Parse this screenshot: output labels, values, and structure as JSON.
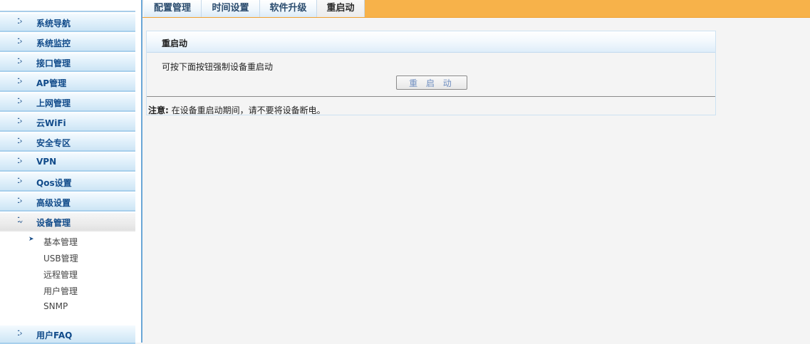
{
  "sidebar": {
    "items": [
      {
        "label": "系统导航"
      },
      {
        "label": "系统监控"
      },
      {
        "label": "接口管理"
      },
      {
        "label": "AP管理"
      },
      {
        "label": "上网管理"
      },
      {
        "label": "云WiFi"
      },
      {
        "label": "安全专区"
      },
      {
        "label": "VPN"
      },
      {
        "label": "Qos设置"
      },
      {
        "label": "高级设置"
      },
      {
        "label": "设备管理",
        "expanded": true
      },
      {
        "label": "用户FAQ"
      }
    ],
    "sub_items": [
      {
        "label": "基本管理",
        "selected": true
      },
      {
        "label": "USB管理"
      },
      {
        "label": "远程管理"
      },
      {
        "label": "用户管理"
      },
      {
        "label": "SNMP"
      }
    ]
  },
  "tabs": [
    {
      "label": "配置管理"
    },
    {
      "label": "时间设置"
    },
    {
      "label": "软件升级"
    },
    {
      "label": "重启动",
      "active": true
    }
  ],
  "panel": {
    "title": "重启动",
    "description": "可按下面按钮强制设备重启动",
    "button_label": "重 启 动",
    "note_label": "注意:",
    "note_text": "在设备重启动期间，请不要将设备断电。"
  },
  "colors": {
    "tab_bar": "#f7b24a",
    "menu_text": "#114b8a",
    "sidebar_border": "#6aa6d6"
  }
}
